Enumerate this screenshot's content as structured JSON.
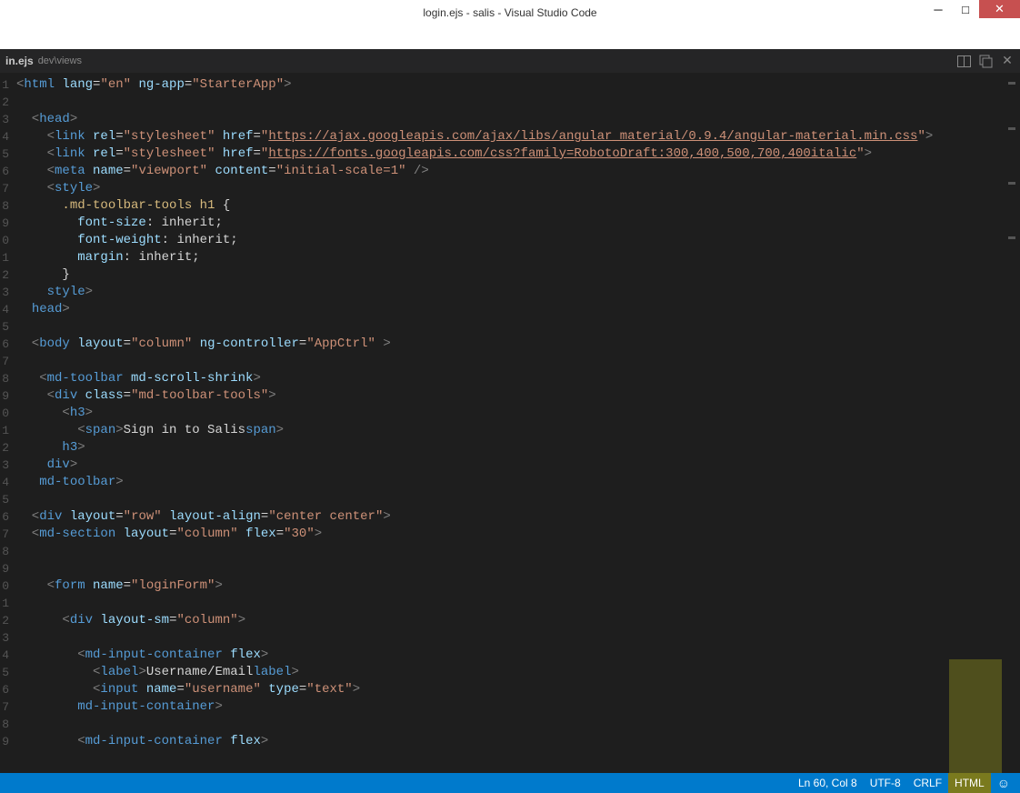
{
  "title": "login.ejs - salis - Visual Studio Code",
  "tab": {
    "name": "in.ejs",
    "path": "dev\\views"
  },
  "status": {
    "pos": "Ln 60, Col 8",
    "encoding": "UTF-8",
    "eol": "CRLF",
    "lang": "HTML",
    "smile": "☺"
  },
  "gutter": [
    "1",
    "2",
    "3",
    "4",
    "5",
    "6",
    "7",
    "8",
    "9",
    "0",
    "1",
    "2",
    "3",
    "4",
    "5",
    "6",
    "7",
    "8",
    "9",
    "0",
    "1",
    "2",
    "3",
    "4",
    "5",
    "6",
    "7",
    "8",
    "9",
    "0",
    "1",
    "2",
    "3",
    "4",
    "5",
    "6",
    "7",
    "8",
    "9"
  ],
  "code": {
    "l1": {
      "pre": "<",
      "tag": "html",
      "sp": " ",
      "a1": "lang",
      "eq": "=",
      "v1": "\"en\"",
      "sp2": " ",
      "a2": "ng-app",
      "eq2": "=",
      "v2": "\"StarterApp\"",
      "post": ">"
    },
    "l3": {
      "pre": "  <",
      "tag": "head",
      "post": ">"
    },
    "l4": {
      "pre": "    <",
      "tag": "link",
      "sp": " ",
      "a1": "rel",
      "eq": "=",
      "v1": "\"stylesheet\"",
      "sp2": " ",
      "a2": "href",
      "eq2": "=",
      "q": "\"",
      "url": "https://ajax.googleapis.com/ajax/libs/angular_material/0.9.4/angular-material.min.css",
      "q2": "\"",
      "post": ">"
    },
    "l5": {
      "pre": "    <",
      "tag": "link",
      "sp": " ",
      "a1": "rel",
      "eq": "=",
      "v1": "\"stylesheet\"",
      "sp2": " ",
      "a2": "href",
      "eq2": "=",
      "q": "\"",
      "url": "https://fonts.googleapis.com/css?family=RobotoDraft:300,400,500,700,400italic",
      "q2": "\"",
      "post": ">"
    },
    "l6": {
      "pre": "    <",
      "tag": "meta",
      "sp": " ",
      "a1": "name",
      "eq": "=",
      "v1": "\"viewport\"",
      "sp2": " ",
      "a2": "content",
      "eq2": "=",
      "v2": "\"initial-scale=1\"",
      "post": " />"
    },
    "l7": {
      "pre": "    <",
      "tag": "style",
      "post": ">"
    },
    "l8": {
      "txt": "      .md-toolbar-tools h1 {"
    },
    "l9": {
      "ind": "        ",
      "prop": "font-size",
      "rest": ": inherit;"
    },
    "l10": {
      "ind": "        ",
      "prop": "font-weight",
      "rest": ": inherit;"
    },
    "l11": {
      "ind": "        ",
      "prop": "margin",
      "rest": ": inherit;"
    },
    "l12": {
      "txt": "      }"
    },
    "l13": {
      "pre": "    </",
      "tag": "style",
      "post": ">"
    },
    "l14": {
      "pre": "  </",
      "tag": "head",
      "post": ">"
    },
    "l16": {
      "pre": "  <",
      "tag": "body",
      "sp": " ",
      "a1": "layout",
      "eq": "=",
      "v1": "\"column\"",
      "sp2": " ",
      "a2": "ng-controller",
      "eq2": "=",
      "v2": "\"AppCtrl\"",
      "post": " >"
    },
    "l18": {
      "pre": "   <",
      "tag": "md-toolbar",
      "sp": " ",
      "a1": "md-scroll-shrink",
      "post": ">"
    },
    "l19": {
      "pre": "    <",
      "tag": "div",
      "sp": " ",
      "a1": "class",
      "eq": "=",
      "v1": "\"md-toolbar-tools\"",
      "post": ">"
    },
    "l20": {
      "pre": "      <",
      "tag": "h3",
      "post": ">"
    },
    "l21": {
      "pre": "        <",
      "tag": "span",
      "post": ">",
      "txt": "Sign in to Salis",
      "pre2": "</",
      "tag2": "span",
      "post2": ">"
    },
    "l22": {
      "pre": "      </",
      "tag": "h3",
      "post": ">"
    },
    "l23": {
      "pre": "    </",
      "tag": "div",
      "post": ">"
    },
    "l24": {
      "pre": "   </",
      "tag": "md-toolbar",
      "post": ">"
    },
    "l26": {
      "pre": "  <",
      "tag": "div",
      "sp": " ",
      "a1": "layout",
      "eq": "=",
      "v1": "\"row\"",
      "sp2": " ",
      "a2": "layout-align",
      "eq2": "=",
      "v2": "\"center center\"",
      "post": ">"
    },
    "l27": {
      "pre": "  <",
      "tag": "md-section",
      "sp": " ",
      "a1": "layout",
      "eq": "=",
      "v1": "\"column\"",
      "sp2": " ",
      "a2": "flex",
      "eq2": "=",
      "v2": "\"30\"",
      "post": ">"
    },
    "l30": {
      "pre": "    <",
      "tag": "form",
      "sp": " ",
      "a1": "name",
      "eq": "=",
      "v1": "\"loginForm\"",
      "post": ">"
    },
    "l32": {
      "pre": "      <",
      "tag": "div",
      "sp": " ",
      "a1": "layout-sm",
      "eq": "=",
      "v1": "\"column\"",
      "post": ">"
    },
    "l34": {
      "pre": "        <",
      "tag": "md-input-container",
      "sp": " ",
      "a1": "flex",
      "post": ">"
    },
    "l35": {
      "pre": "          <",
      "tag": "label",
      "post": ">",
      "txt": "Username/Email",
      "pre2": "</",
      "tag2": "label",
      "post2": ">"
    },
    "l36": {
      "pre": "          <",
      "tag": "input",
      "sp": " ",
      "a1": "name",
      "eq": "=",
      "v1": "\"username\"",
      "sp2": " ",
      "a2": "type",
      "eq2": "=",
      "v2": "\"text\"",
      "post": ">"
    },
    "l37": {
      "pre": "        </",
      "tag": "md-input-container",
      "post": ">"
    },
    "l39": {
      "pre": "        <",
      "tag": "md-input-container",
      "sp": " ",
      "a1": "flex",
      "post": ">"
    }
  }
}
